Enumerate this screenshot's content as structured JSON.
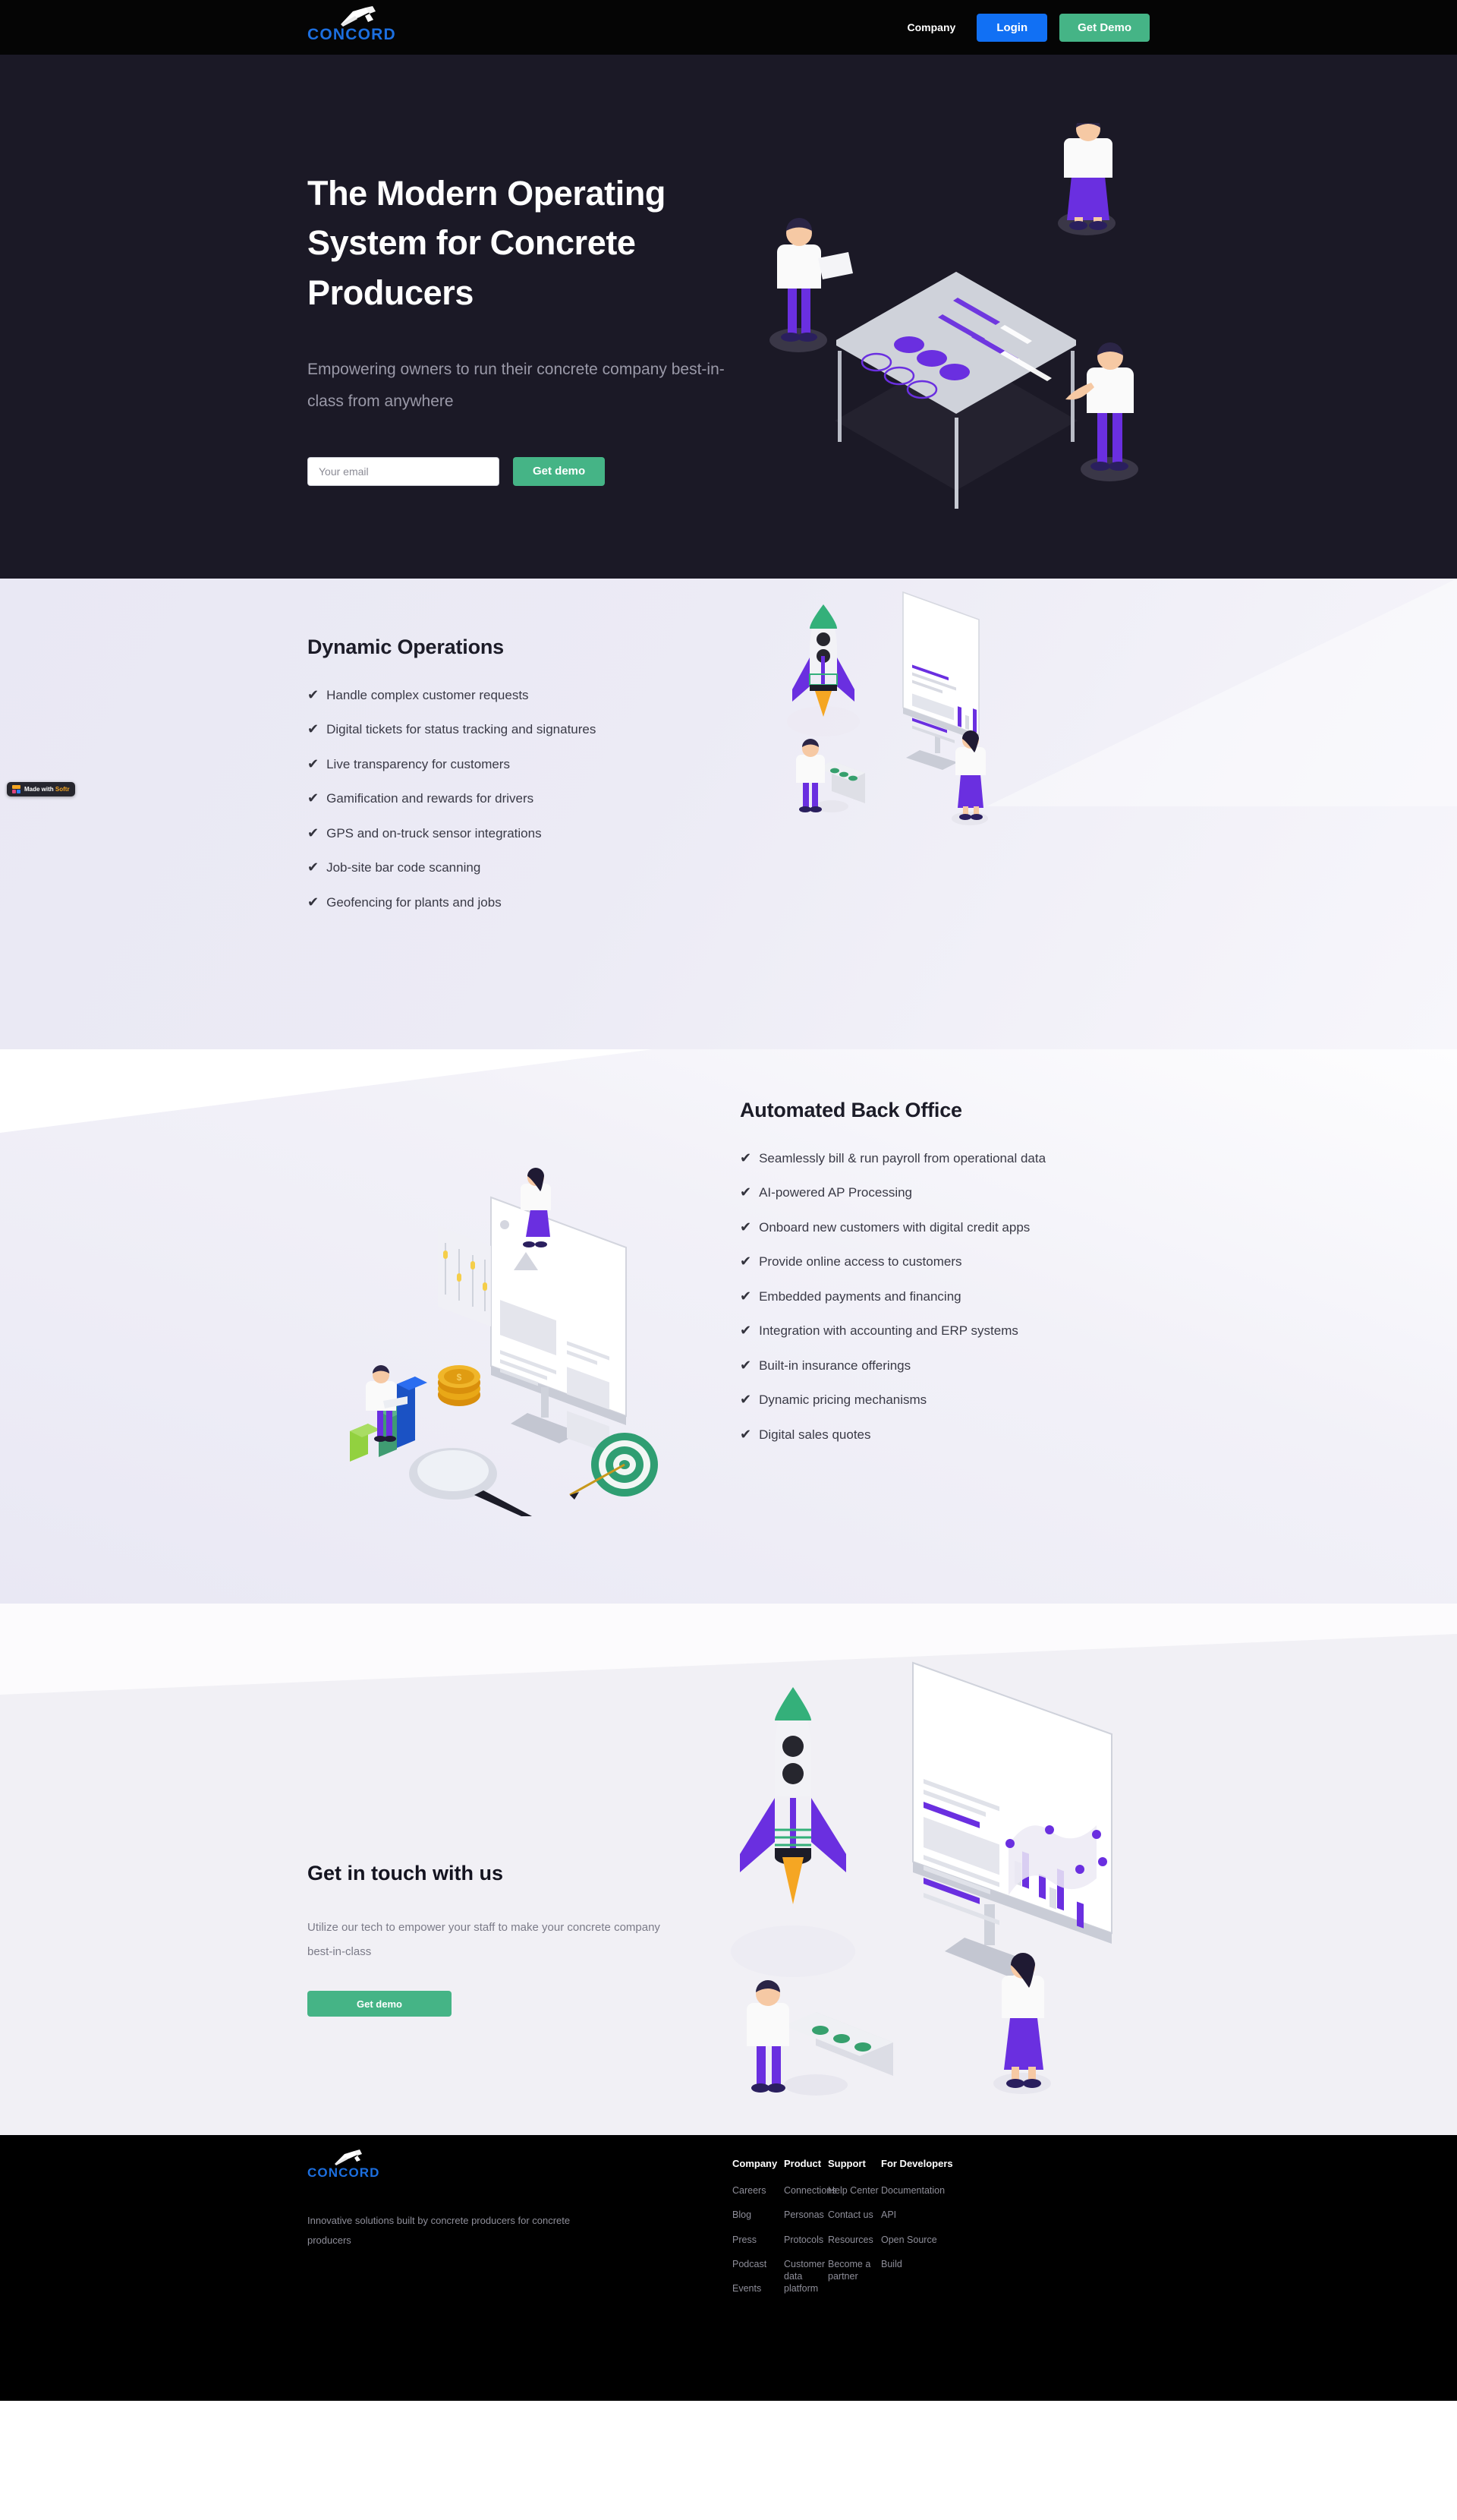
{
  "brand": {
    "name": "CONCORD",
    "logo_color": "#1c6fe0",
    "accent_green": "#45b486",
    "accent_blue": "#1170f4",
    "illustration_purple": "#6a2fe0"
  },
  "header": {
    "nav_link": "Company",
    "login_label": "Login",
    "demo_label": "Get Demo"
  },
  "hero": {
    "title": "The Modern Operating System for Concrete Producers",
    "subtitle": "Empowering owners to run their concrete company best-in-class from anywhere",
    "email_placeholder": "Your email",
    "email_value": "",
    "cta_label": "Get demo"
  },
  "operations": {
    "title": "Dynamic Operations",
    "check_glyph": "✔",
    "items": [
      "Handle complex customer requests",
      "Digital tickets for status tracking and signatures",
      "Live transparency for customers",
      "Gamification and rewards for drivers",
      "GPS and on-truck sensor integrations",
      "Job-site bar code scanning",
      "Geofencing for plants and jobs"
    ]
  },
  "back_office": {
    "title": "Automated Back Office",
    "check_glyph": "✔",
    "items": [
      "Seamlessly bill & run payroll from operational data",
      "AI-powered AP Processing",
      "Onboard new customers with digital credit apps",
      "Provide online access to customers",
      "Embedded payments and financing",
      "Integration with accounting and ERP systems",
      "Built-in insurance offerings",
      "Dynamic pricing mechanisms",
      "Digital sales quotes"
    ]
  },
  "contact": {
    "title": "Get in touch with us",
    "subtitle": "Utilize our tech to empower your staff to make your concrete company best-in-class",
    "cta_label": "Get demo"
  },
  "footer": {
    "tagline": "Innovative solutions built by concrete producers for concrete producers",
    "columns": [
      {
        "heading": "Company",
        "links": [
          "Careers",
          "Blog",
          "Press",
          "Podcast",
          "Events"
        ]
      },
      {
        "heading": "Product",
        "links": [
          "Connections",
          "Personas",
          "Protocols",
          "Customer data platform"
        ]
      },
      {
        "heading": "Support",
        "links": [
          "Help Center",
          "Contact us",
          "Resources",
          "Become a partner"
        ]
      },
      {
        "heading": "For Developers",
        "links": [
          "Documentation",
          "API",
          "Open Source",
          "Build"
        ]
      }
    ]
  },
  "badge": {
    "prefix": "Made with ",
    "brand": "Softr"
  }
}
